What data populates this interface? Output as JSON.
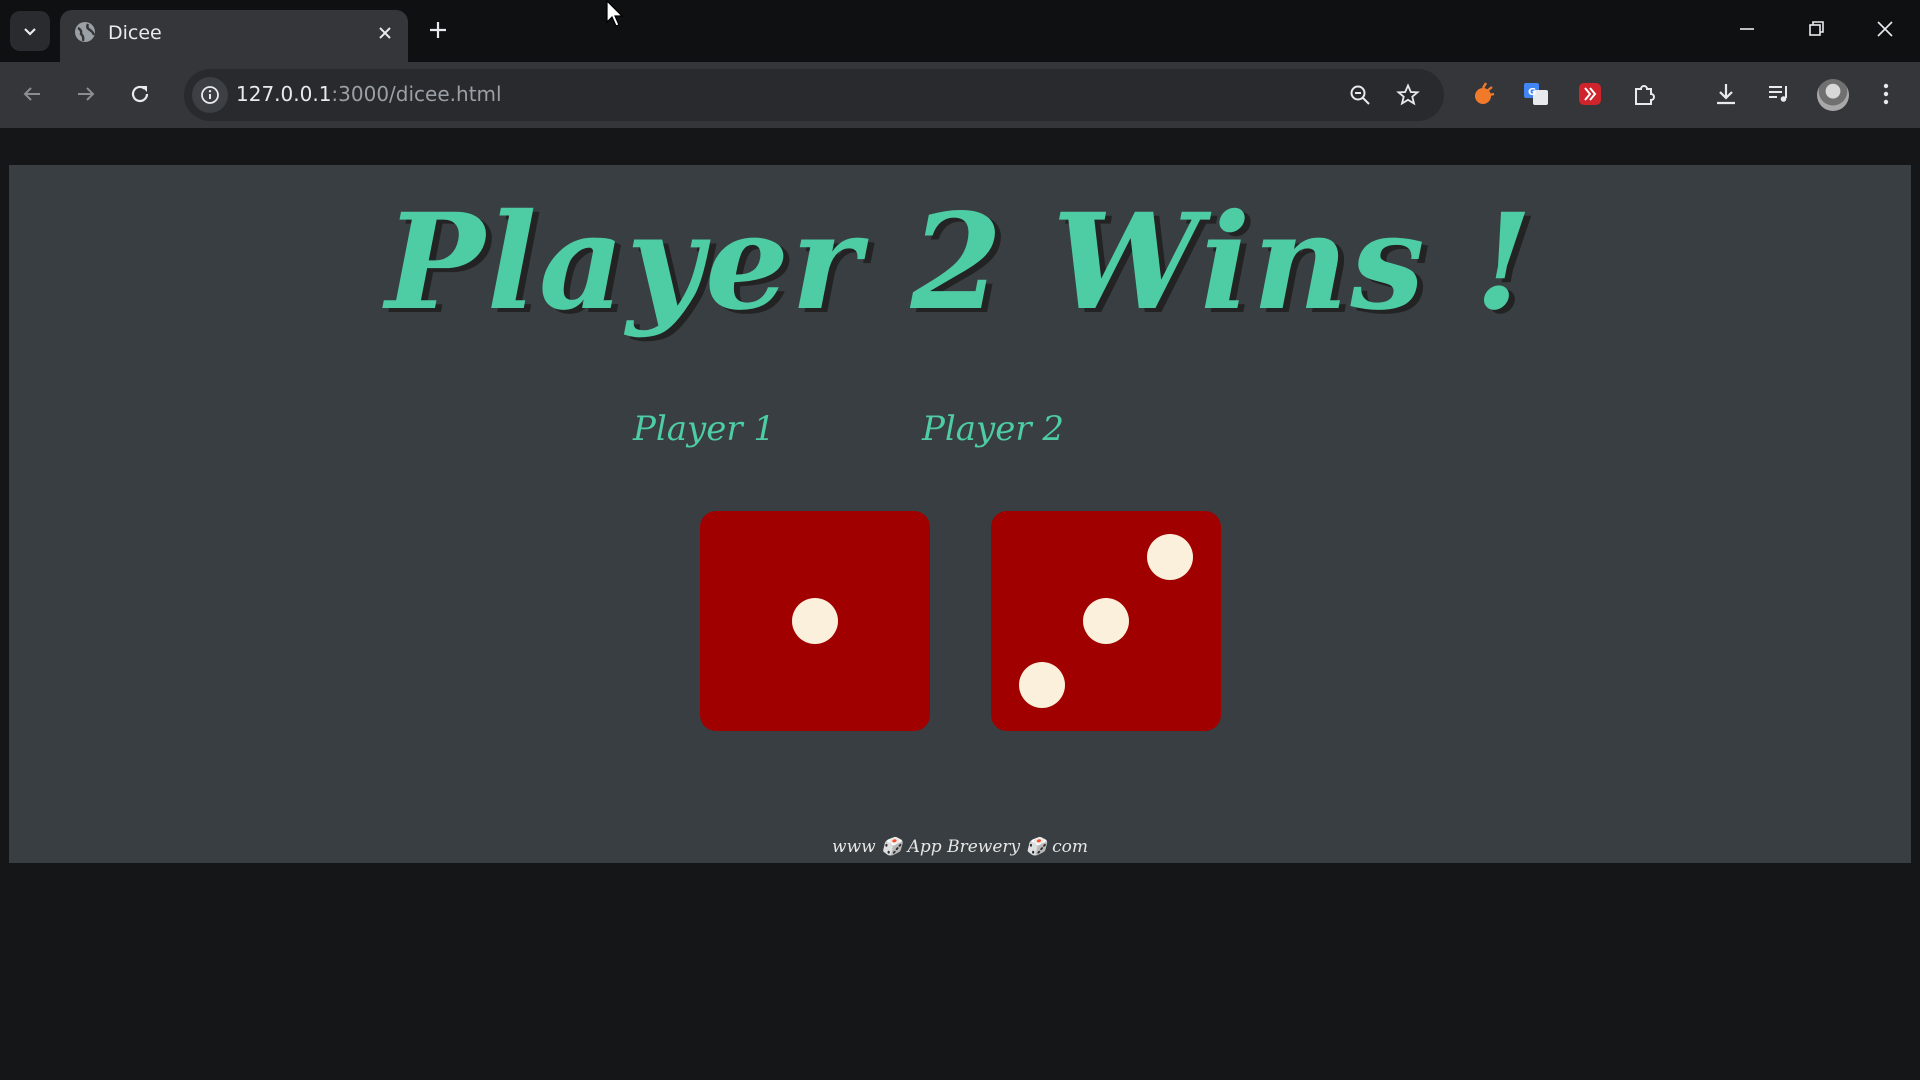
{
  "browser": {
    "tab": {
      "title": "Dicee"
    },
    "address": {
      "host": "127.0.0.1",
      "rest": ":3000/dicee.html"
    }
  },
  "page": {
    "headline": "Player 2 Wins !",
    "players": [
      {
        "label": "Player 1",
        "die_value": 1
      },
      {
        "label": "Player 2",
        "die_value": 3
      }
    ],
    "footer": "www 🎲 App Brewery 🎲 com"
  },
  "colors": {
    "accent": "#4ecca3",
    "die": "#a10000",
    "pip": "#faf0dc",
    "page_bg": "#383e42"
  }
}
